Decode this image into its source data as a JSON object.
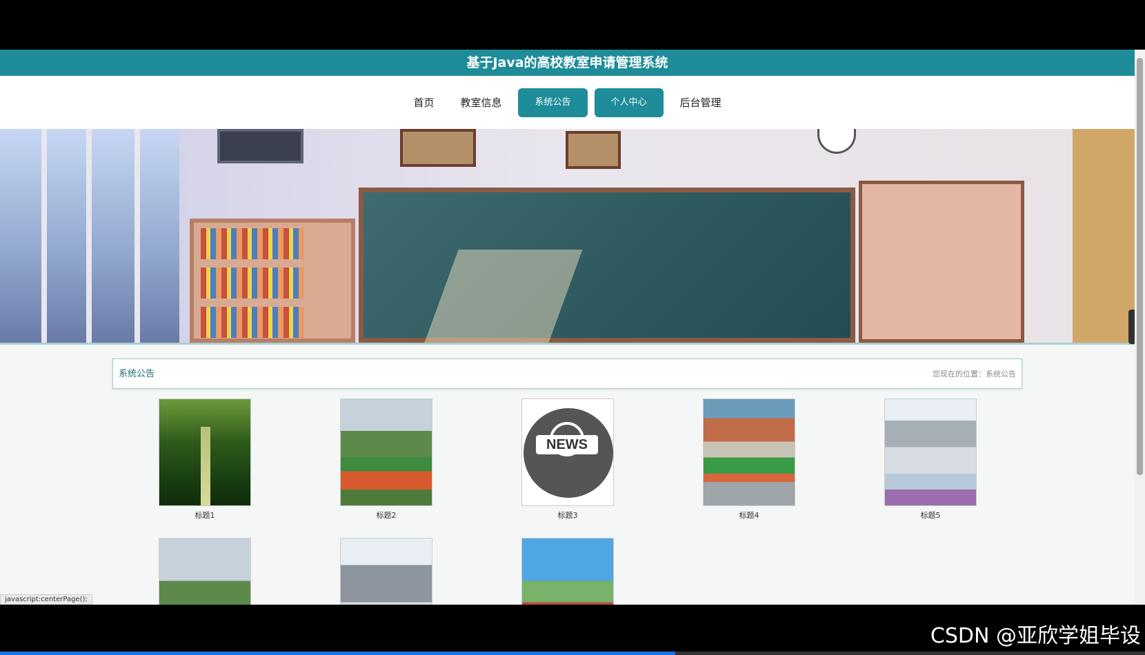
{
  "header": {
    "title": "基于Java的高校教室申请管理系统"
  },
  "nav": {
    "items": [
      {
        "label": "首页",
        "active": false
      },
      {
        "label": "教室信息",
        "active": false
      },
      {
        "label": "系统公告",
        "active": true
      },
      {
        "label": "个人中心",
        "active": true
      },
      {
        "label": "后台管理",
        "active": false
      }
    ]
  },
  "banner": {
    "slide_count": 4,
    "active_slide": 1
  },
  "section": {
    "title": "系统公告",
    "breadcrumb": "您现在的位置：系统公告"
  },
  "cards": [
    {
      "label": "标题1"
    },
    {
      "label": "标题2"
    },
    {
      "label": "标题3",
      "image_text": "NEWS"
    },
    {
      "label": "标题4"
    },
    {
      "label": "标题5"
    },
    {
      "label": ""
    },
    {
      "label": ""
    },
    {
      "label": ""
    }
  ],
  "status": {
    "text": "javascript:centerPage();"
  },
  "watermark": {
    "text": "CSDN @亚欣学姐毕设"
  },
  "video_progress": 0.59,
  "colors": {
    "accent": "#1e8c99"
  }
}
